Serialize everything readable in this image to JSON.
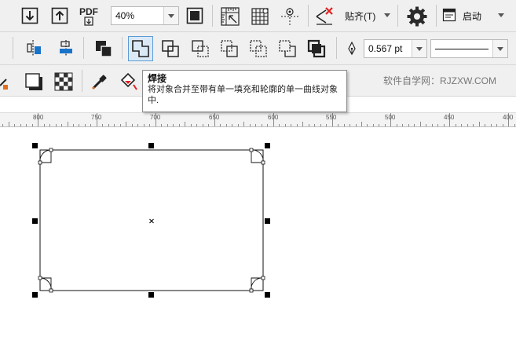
{
  "toolbar_top": {
    "import_icon": "download-arrow",
    "export_icon": "upload-arrow",
    "pdf_label": "PDF",
    "zoom_value": "40%",
    "fullscreen_icon": "fullscreen-box",
    "snap_label": "贴齐(T)",
    "launch_label": "启动"
  },
  "toolbar_shaping": {
    "pen_width": "0.567 pt",
    "active_tool": "weld"
  },
  "tooltip": {
    "title": "焊接",
    "description": "将对象合并至带有单一填充和轮廓的单一曲线对象中."
  },
  "watermark": "软件自学网：RJZXW.COM",
  "ruler": {
    "labels": [
      "800",
      "750",
      "700",
      "650",
      "600",
      "550",
      "500",
      "450",
      "400"
    ]
  },
  "colors": {
    "toolbar_bg": "#f0f0f0",
    "accent_blue": "#1a73c9",
    "accent_red": "#e02020",
    "selected_bg": "#dbe9f7"
  }
}
